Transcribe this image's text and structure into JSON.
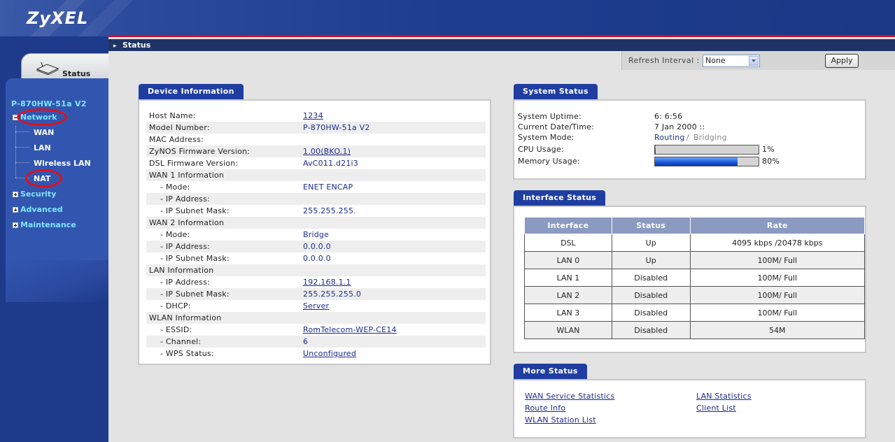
{
  "header": {
    "logo": "ZyXEL"
  },
  "nav": {
    "status_tab": "Status",
    "device": "P-870HW-51a V2",
    "network": {
      "label": "Network",
      "expanded": true,
      "children": [
        "WAN",
        "LAN",
        "Wireless LAN",
        "NAT"
      ]
    },
    "security": "Security",
    "advanced": "Advanced",
    "maintenance": "Maintenance"
  },
  "breadcrumb": "Status",
  "refresh": {
    "label": "Refresh Interval :",
    "selected": "None",
    "apply": "Apply"
  },
  "device_info": {
    "title": "Device Information",
    "rows": [
      {
        "label": "Host Name:",
        "value": "1234",
        "link": true
      },
      {
        "label": "Model Number:",
        "value": "P-870HW-51a V2",
        "link": false
      },
      {
        "label": "MAC Address:",
        "value": "",
        "link": false
      },
      {
        "label": "ZyNOS Firmware Version:",
        "value": "1.00(BKO.1)",
        "link": true
      },
      {
        "label": "DSL Firmware Version:",
        "value": "AvC011.d21i3",
        "link": false
      },
      {
        "label": "WAN 1 Information",
        "value": "",
        "link": false
      },
      {
        "label": "- Mode:",
        "value": "ENET ENCAP",
        "link": false
      },
      {
        "label": "- IP Address:",
        "value": "",
        "link": false
      },
      {
        "label": "- IP Subnet Mask:",
        "value": "255.255.255.",
        "link": false
      },
      {
        "label": "WAN 2 Information",
        "value": "",
        "link": false
      },
      {
        "label": "- Mode:",
        "value": "Bridge",
        "link": false
      },
      {
        "label": "- IP Address:",
        "value": "0.0.0.0",
        "link": false
      },
      {
        "label": "- IP Subnet Mask:",
        "value": "0.0.0.0",
        "link": false
      },
      {
        "label": "LAN Information",
        "value": "",
        "link": false
      },
      {
        "label": "- IP Address:",
        "value": "192.168.1.1",
        "link": true
      },
      {
        "label": "- IP Subnet Mask:",
        "value": "255.255.255.0",
        "link": false
      },
      {
        "label": "- DHCP:",
        "value": "Server",
        "link": true
      },
      {
        "label": "WLAN Information",
        "value": "",
        "link": false
      },
      {
        "label": "- ESSID:",
        "value": "RomTelecom-WEP-CE14",
        "link": true
      },
      {
        "label": "- Channel:",
        "value": "6",
        "link": false
      },
      {
        "label": "- WPS Status:",
        "value": "Unconfigured",
        "link": true
      }
    ]
  },
  "system_status": {
    "title": "System Status",
    "uptime_label": "System Uptime:",
    "uptime": "6: 6:56",
    "date_label": "Current Date/Time:",
    "date": "7 Jan 2000 ::",
    "mode_label": "System Mode:",
    "mode_active": "Routing",
    "mode_sep": "/",
    "mode_inactive": "Bridging",
    "cpu_label": "CPU Usage:",
    "cpu": "1%",
    "cpu_fraction": 0.01,
    "mem_label": "Memory Usage:",
    "mem": "80%",
    "mem_fraction": 0.8
  },
  "interface_status": {
    "title": "Interface Status",
    "headers": [
      "Interface",
      "Status",
      "Rate"
    ],
    "rows": [
      [
        "DSL",
        "Up",
        "4095 kbps /20478 kbps"
      ],
      [
        "LAN 0",
        "Up",
        "100M/ Full"
      ],
      [
        "LAN 1",
        "Disabled",
        "100M/ Full"
      ],
      [
        "LAN 2",
        "Disabled",
        "100M/ Full"
      ],
      [
        "LAN 3",
        "Disabled",
        "100M/ Full"
      ],
      [
        "WLAN",
        "Disabled",
        "54M"
      ]
    ]
  },
  "more_status": {
    "title": "More Status",
    "links": [
      "WAN Service Statistics",
      "LAN Statistics",
      "Route Info",
      "Client List",
      "WLAN Station List"
    ]
  }
}
